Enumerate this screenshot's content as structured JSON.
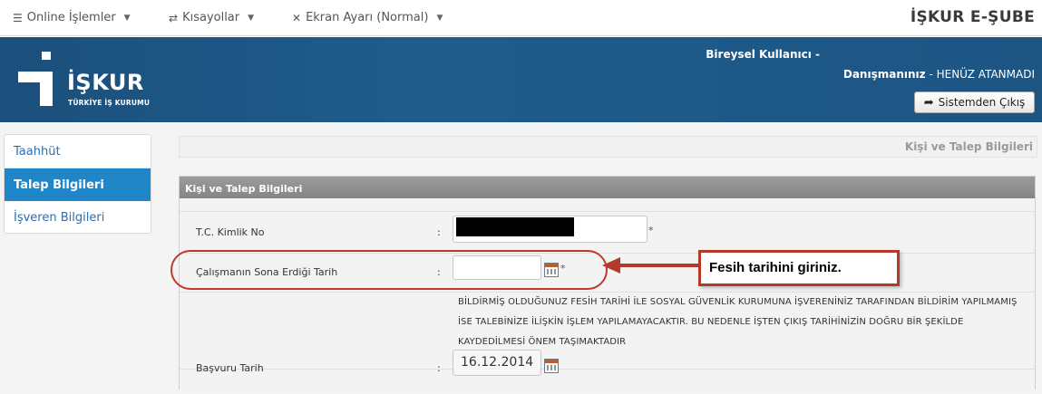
{
  "topnav": {
    "online_label": "Online İşlemler",
    "shortcuts_label": "Kısayollar",
    "screen_label": "Ekran Ayarı (Normal)",
    "brand": "İŞKUR E-ŞUBE"
  },
  "header": {
    "logo_word": "İŞKUR",
    "logo_sub": "TÜRKİYE İŞ KURUMU",
    "user_label": "Bireysel Kullanıcı -",
    "consultant_label": "Danışmanınız",
    "consultant_value": "- HENÜZ ATANMADI",
    "logout_label": "Sistemden Çıkış",
    "brand_color": "#1f5c8c"
  },
  "sidebar": {
    "items": [
      {
        "label": "Taahhüt",
        "active": false
      },
      {
        "label": "Talep Bilgileri",
        "active": true
      },
      {
        "label": "İşveren Bilgileri",
        "active": false
      }
    ]
  },
  "page": {
    "title": "Kişi ve Talep Bilgileri",
    "panel_title": "Kişi ve Talep Bilgileri"
  },
  "form": {
    "tc_label": "T.C. Kimlik No",
    "end_date_label": "Çalışmanın Sona Erdiği Tarih",
    "end_date_value": "",
    "notice": "BİLDİRMİŞ OLDUĞUNUZ FESİH TARİHİ İLE SOSYAL GÜVENLİK KURUMUNA İŞVERENİNİZ TARAFINDAN BİLDİRİM YAPILMAMIŞ İSE TALEBİNİZE İLİŞKİN İŞLEM YAPILAMAYACAKTIR. BU NEDENLE İŞTEN ÇIKIŞ TARİHİNİZİN DOĞRU BİR ŞEKİLDE KAYDEDİLMESİ ÖNEM TAŞIMAKTADIR",
    "apply_label": "Başvuru Tarih",
    "apply_value": "16.12.2014",
    "colon": ":",
    "required_mark": "*"
  },
  "annotation": {
    "callout_text": "Fesih tarihini giriniz.",
    "color": "#b23a2b"
  }
}
